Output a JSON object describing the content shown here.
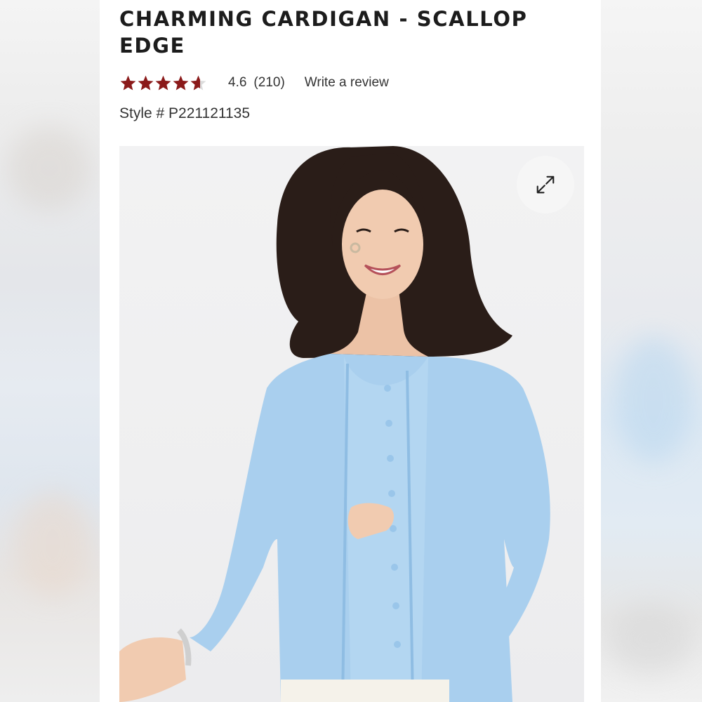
{
  "product": {
    "title": "CHARMING CARDIGAN - SCALLOP EDGE",
    "rating_value": "4.6",
    "review_count": "(210)",
    "rating": 4.6,
    "rating_max": 5,
    "write_review_label": "Write a review",
    "style_number": "Style # P221121135"
  },
  "image": {
    "expand_icon": "expand-diagonal-arrows-icon",
    "subject": "model-wearing-light-blue-scallop-cardigan"
  },
  "colors": {
    "star_fill": "#8b1a1a",
    "star_empty": "#dcdcdc",
    "cardigan_blue": "#a9cfee",
    "hair": "#2a1d18"
  }
}
